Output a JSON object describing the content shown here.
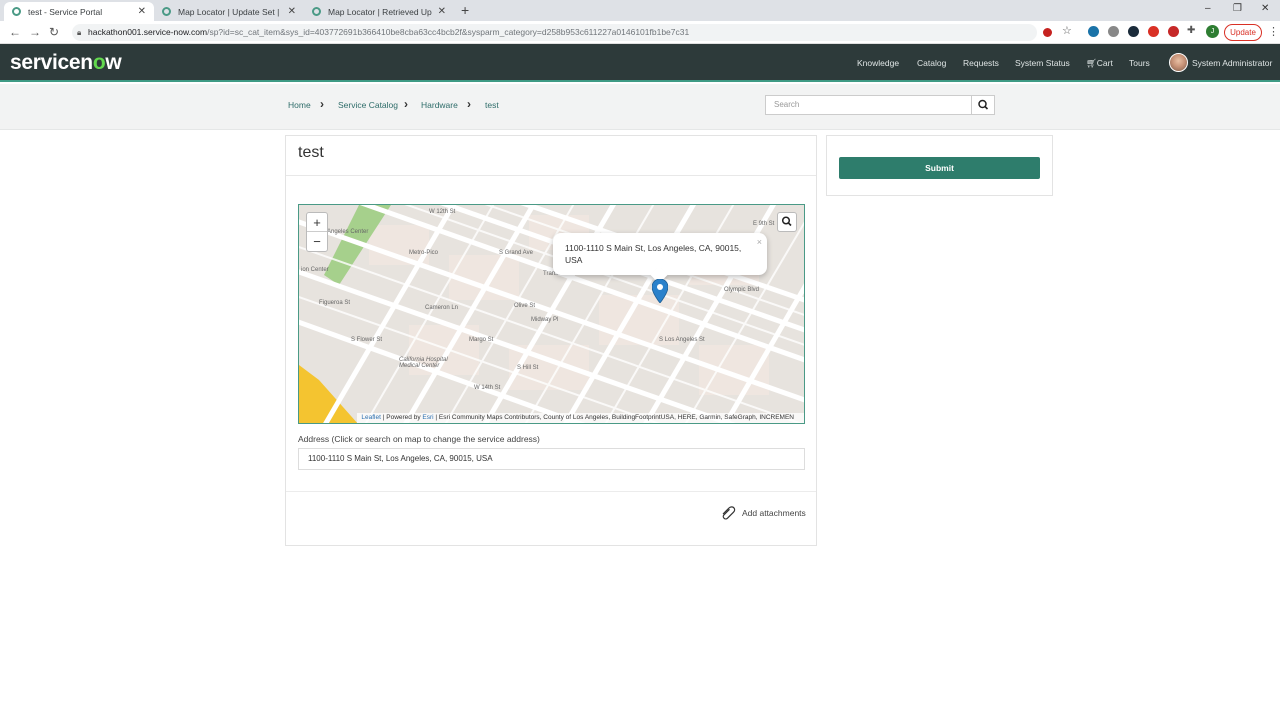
{
  "browser": {
    "tabs": [
      {
        "title": "test - Service Portal",
        "active": true
      },
      {
        "title": "Map Locator | Update Set | Servic",
        "active": false
      },
      {
        "title": "Map Locator | Retrieved Update",
        "active": false
      }
    ],
    "url_host": "hackathon001.service-now.com",
    "url_path": "/sp?id=sc_cat_item&sys_id=403772691b366410be8cba63cc4bcb2f&sysparm_category=d258b953c611227a0146101fb1be7c31",
    "update_label": "Update",
    "profile_initial": "J"
  },
  "header": {
    "logo_main": "servicen",
    "logo_o": "o",
    "logo_end": "w",
    "nav": [
      "Knowledge",
      "Catalog",
      "Requests",
      "System Status",
      "Cart",
      "Tours"
    ],
    "user": "System Administrator",
    "brand_color": "#2d3a3a",
    "accent_color": "#3e9a84"
  },
  "breadcrumb": {
    "items": [
      "Home",
      "Service Catalog",
      "Hardware",
      "test"
    ]
  },
  "search": {
    "placeholder": "Search"
  },
  "item": {
    "title": "test",
    "map": {
      "popup_text": "1100-1110 S Main St, Los Angeles, CA, 90015, USA",
      "attribution_leaflet": "Leaflet",
      "attribution_powered": " | Powered by ",
      "attribution_esri": "Esri",
      "attribution_rest": " | Esri Community Maps Contributors, County of Los Angeles, BuildingFootprintUSA, HERE, Garmin, SafeGraph, INCREMEN",
      "labels": [
        "W 12th St",
        "S Grand Ave",
        "Metro-Pico",
        "Angeles Center",
        "ion Center",
        "Figueroa St",
        "Cameron Ln",
        "Transamerica Occidental Life",
        "Olive St",
        "Midway Pl",
        "S Flower St",
        "Margo St",
        "S Hill St",
        "W 14th St",
        "California Hospital Medical Center",
        "S Los Angeles St",
        "Olympic Blvd",
        "E 9th St"
      ]
    },
    "address_label": "Address (Click or search on map to change the service address)",
    "address_value": "1100-1110 S Main St, Los Angeles, CA, 90015, USA",
    "attachments_label": "Add attachments"
  },
  "actions": {
    "submit_label": "Submit",
    "submit_color": "#2e7d6c"
  }
}
